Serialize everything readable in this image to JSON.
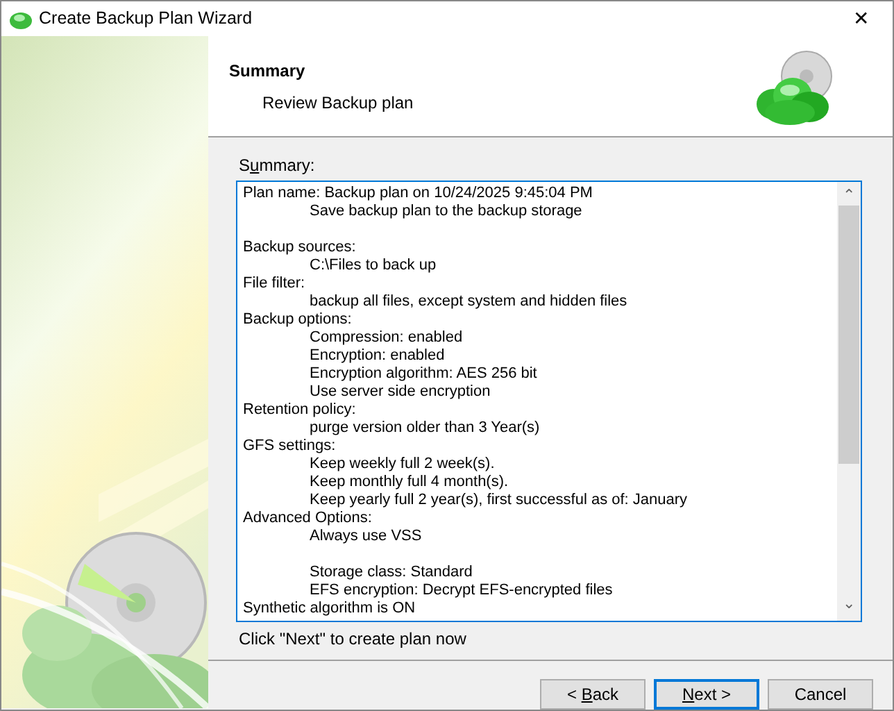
{
  "window": {
    "title": "Create Backup Plan Wizard",
    "close": "✕"
  },
  "header": {
    "title": "Summary",
    "subtitle": "Review Backup plan"
  },
  "summary": {
    "label": {
      "before": "S",
      "access_key": "u",
      "after": "mmary:"
    },
    "blocks": [
      [
        {
          "heading": "Plan name: Backup plan on 10/24/2025 9:45:04 PM",
          "details": [
            "Save backup plan to the backup storage"
          ]
        }
      ],
      [
        {
          "heading": "Backup sources:",
          "details": [
            "C:\\Files to back up"
          ]
        },
        {
          "heading": "File filter:",
          "details": [
            "backup all files, except system and hidden files"
          ]
        },
        {
          "heading": "Backup options:",
          "details": [
            "Compression: enabled",
            "Encryption: enabled",
            "Encryption algorithm: AES 256 bit",
            "Use server side encryption"
          ]
        },
        {
          "heading": "Retention policy:",
          "details": [
            "purge version older than 3 Year(s)"
          ]
        },
        {
          "heading": "GFS settings:",
          "details": [
            "Keep weekly full 2 week(s).",
            "Keep monthly full 4 month(s).",
            "Keep yearly full 2 year(s), first successful as of: January"
          ]
        },
        {
          "heading": "Advanced Options:",
          "details": [
            "Always use VSS"
          ]
        }
      ],
      [
        {
          "details": [
            "Storage class: Standard",
            "EFS encryption: Decrypt EFS-encrypted files"
          ]
        },
        {
          "heading": "Synthetic algorithm is ON"
        }
      ]
    ],
    "scroll_up": "⌃",
    "scroll_down": "⌄"
  },
  "hint": "Click \"Next\" to create plan now",
  "buttons": [
    {
      "label": {
        "before": "< ",
        "access_key": "B",
        "after": "ack"
      },
      "default": false
    },
    {
      "label": {
        "access_key": "N",
        "after": "ext >"
      },
      "default": true
    },
    {
      "label": {
        "before": "Cancel"
      },
      "default": false
    }
  ]
}
